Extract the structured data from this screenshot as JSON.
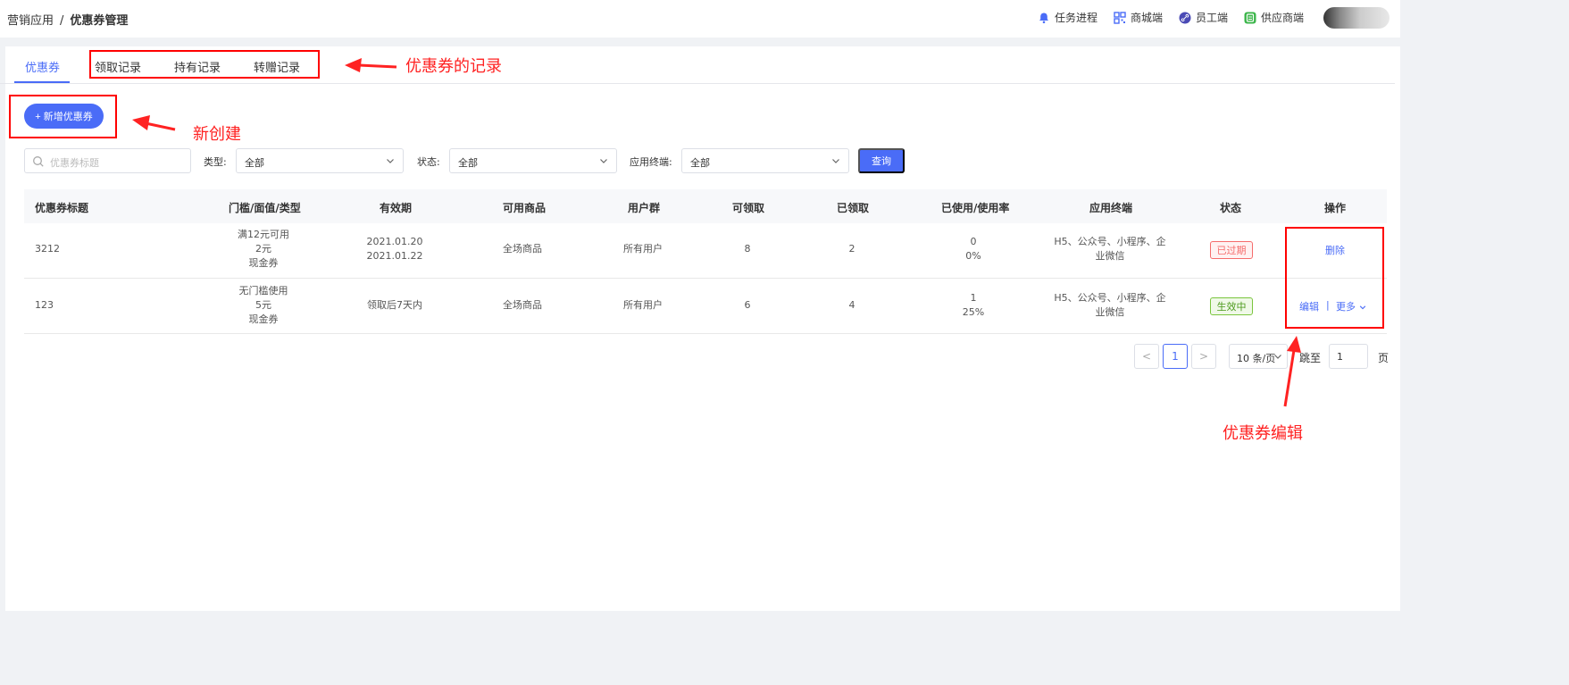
{
  "breadcrumb": {
    "parent": "营销应用",
    "separator": "/",
    "current": "优惠券管理"
  },
  "header_links": [
    {
      "label": "任务进程",
      "icon": "bell-icon"
    },
    {
      "label": "商城端",
      "icon": "qrcode-icon"
    },
    {
      "label": "员工端",
      "icon": "link-icon"
    },
    {
      "label": "供应商端",
      "icon": "supplier-icon"
    }
  ],
  "tabs": [
    {
      "label": "优惠券",
      "active": true
    },
    {
      "label": "领取记录"
    },
    {
      "label": "持有记录"
    },
    {
      "label": "转赠记录"
    }
  ],
  "add_button": {
    "label": "+ 新增优惠券"
  },
  "filters": {
    "search_placeholder": "优惠券标题",
    "type_label": "类型:",
    "type_value": "全部",
    "status_label": "状态:",
    "status_value": "全部",
    "terminal_label": "应用终端:",
    "terminal_value": "全部",
    "query_label": "查询"
  },
  "table": {
    "columns": [
      "优惠券标题",
      "门槛/面值/类型",
      "有效期",
      "可用商品",
      "用户群",
      "可领取",
      "已领取",
      "已使用/使用率",
      "应用终端",
      "状态",
      "操作"
    ],
    "rows": [
      {
        "title": "3212",
        "threshold": "满12元可用",
        "face_value": "2元",
        "coupon_type": "现金券",
        "validity_1": "2021.01.20",
        "validity_2": "2021.01.22",
        "goods": "全场商品",
        "users": "所有用户",
        "available": "8",
        "claimed": "2",
        "used": "0",
        "usage_rate": "0%",
        "terminal_1": "H5、公众号、小程序、企",
        "terminal_2": "业微信",
        "status": "已过期",
        "actions": [
          "删除"
        ]
      },
      {
        "title": "123",
        "threshold": "无门槛使用",
        "face_value": "5元",
        "coupon_type": "现金券",
        "validity_1": "领取后7天内",
        "goods": "全场商品",
        "users": "所有用户",
        "available": "6",
        "claimed": "4",
        "used": "1",
        "usage_rate": "25%",
        "terminal_1": "H5、公众号、小程序、企",
        "terminal_2": "业微信",
        "status": "生效中",
        "actions": [
          "编辑",
          "|",
          "更多"
        ]
      }
    ]
  },
  "pagination": {
    "prev": "<",
    "current_page": "1",
    "next": ">",
    "page_size": "10 条/页",
    "jump_label": "跳至",
    "jump_value": "1",
    "page_suffix": "页"
  },
  "annotations": {
    "records": "优惠券的记录",
    "create": "新创建",
    "edit": "优惠券编辑"
  },
  "colors": {
    "accent": "#4a6cf7",
    "annotation": "#ff0000",
    "expired": "#f56c6c",
    "active": "#4c9a1c"
  }
}
